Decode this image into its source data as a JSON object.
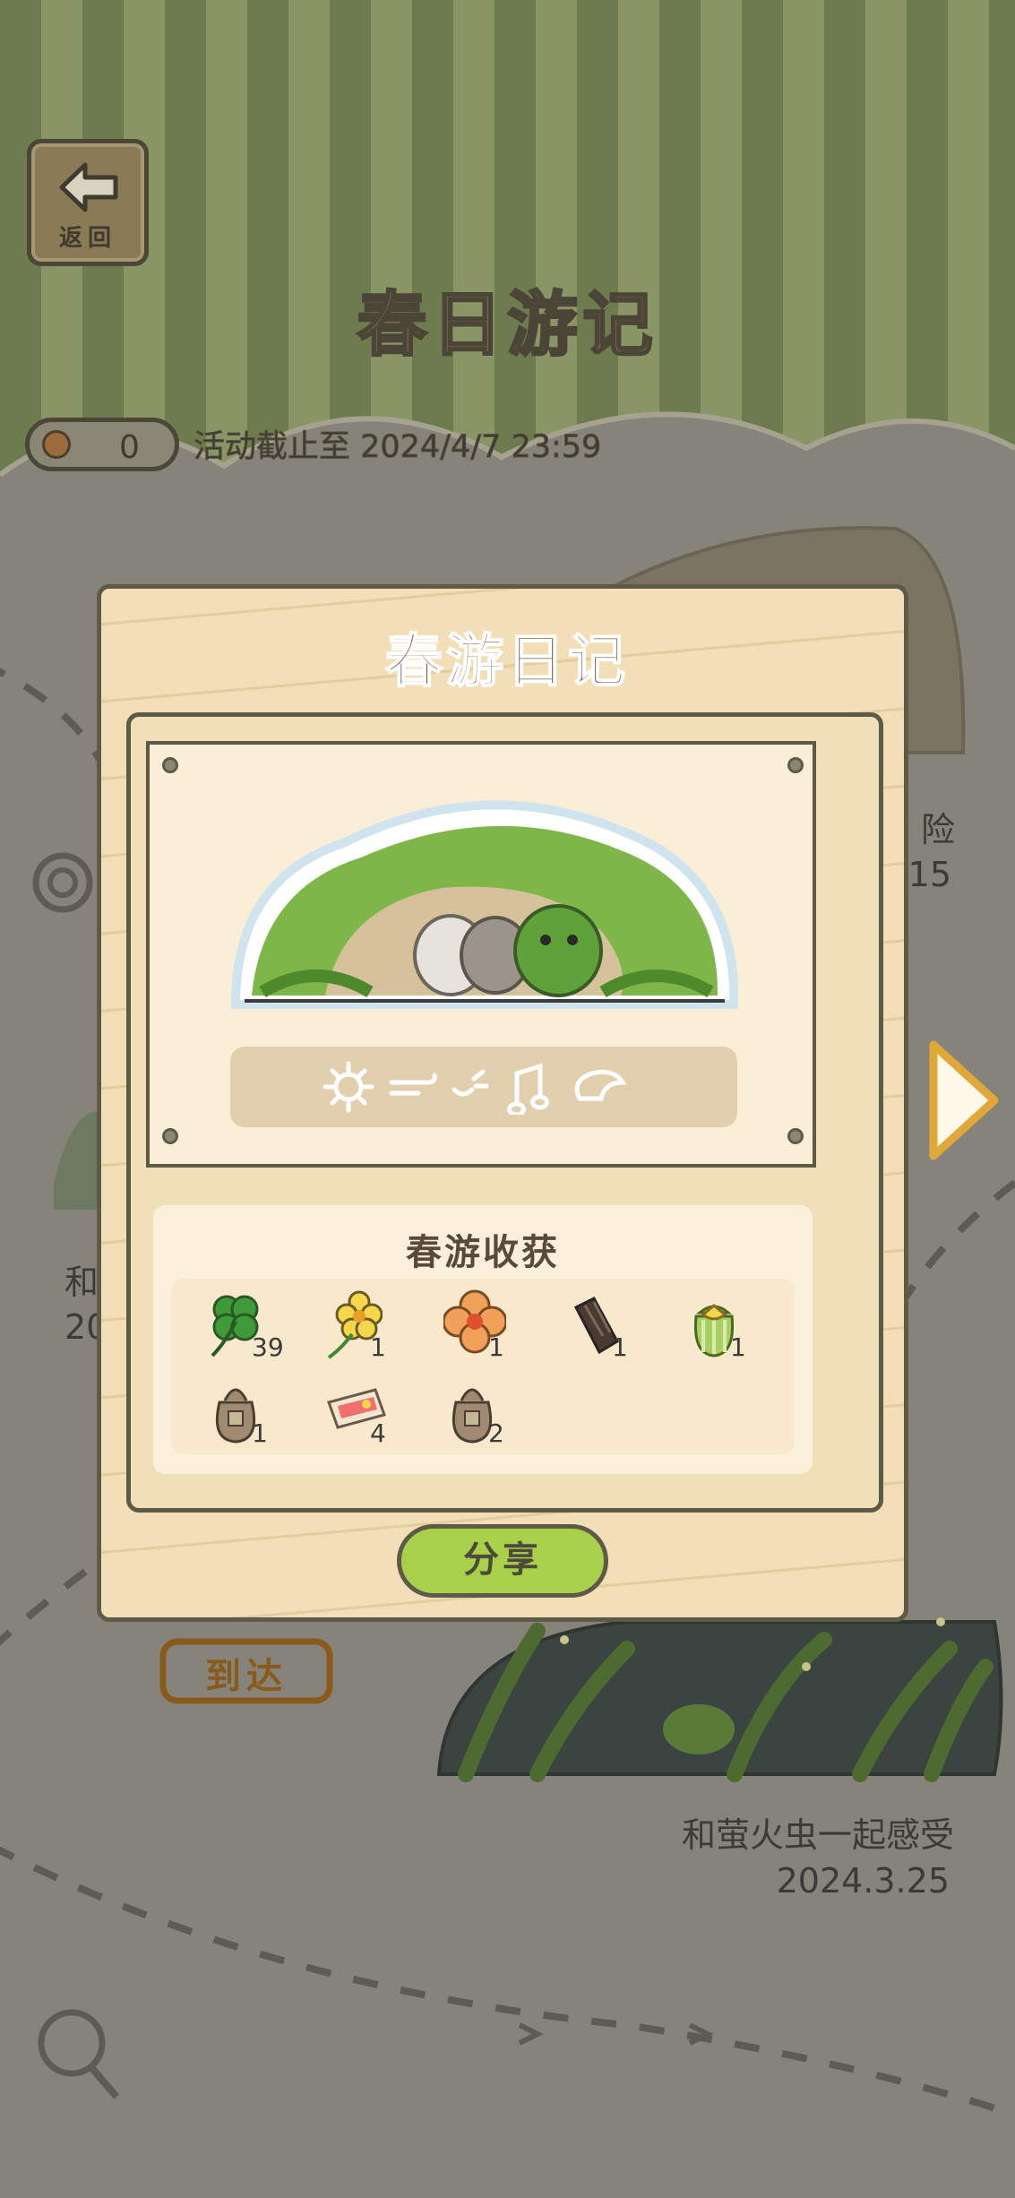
{
  "header": {
    "back_label": "返回",
    "title": "春日游记",
    "coin_count": "0",
    "deadline": "活动截止至 2024/4/7 23:59"
  },
  "map": {
    "partial_label_1": "险",
    "partial_date_1": "15",
    "partial_label_2": "和",
    "partial_date_2": "20",
    "arrive_label": "到达",
    "scene_title": "和萤火虫一起感受",
    "scene_date": "2024.3.25"
  },
  "modal": {
    "title": "春游日记",
    "harvest_title": "春游收获",
    "share_label": "分享",
    "items": [
      {
        "icon": "four-leaf-clover-icon",
        "count": "39"
      },
      {
        "icon": "yellow-flower-icon",
        "count": "1"
      },
      {
        "icon": "orange-flower-icon",
        "count": "1"
      },
      {
        "icon": "wood-icon",
        "count": "1"
      },
      {
        "icon": "green-gift-bag-icon",
        "count": "1"
      },
      {
        "icon": "sack-icon",
        "count": "1"
      },
      {
        "icon": "ticket-icon",
        "count": "4"
      },
      {
        "icon": "sack-icon",
        "count": "2"
      }
    ]
  },
  "colors": {
    "dim_background": "#86837b",
    "modal_wood": "#f2dfb8",
    "share_green": "#a8d04a",
    "outline": "#5d5a48"
  }
}
